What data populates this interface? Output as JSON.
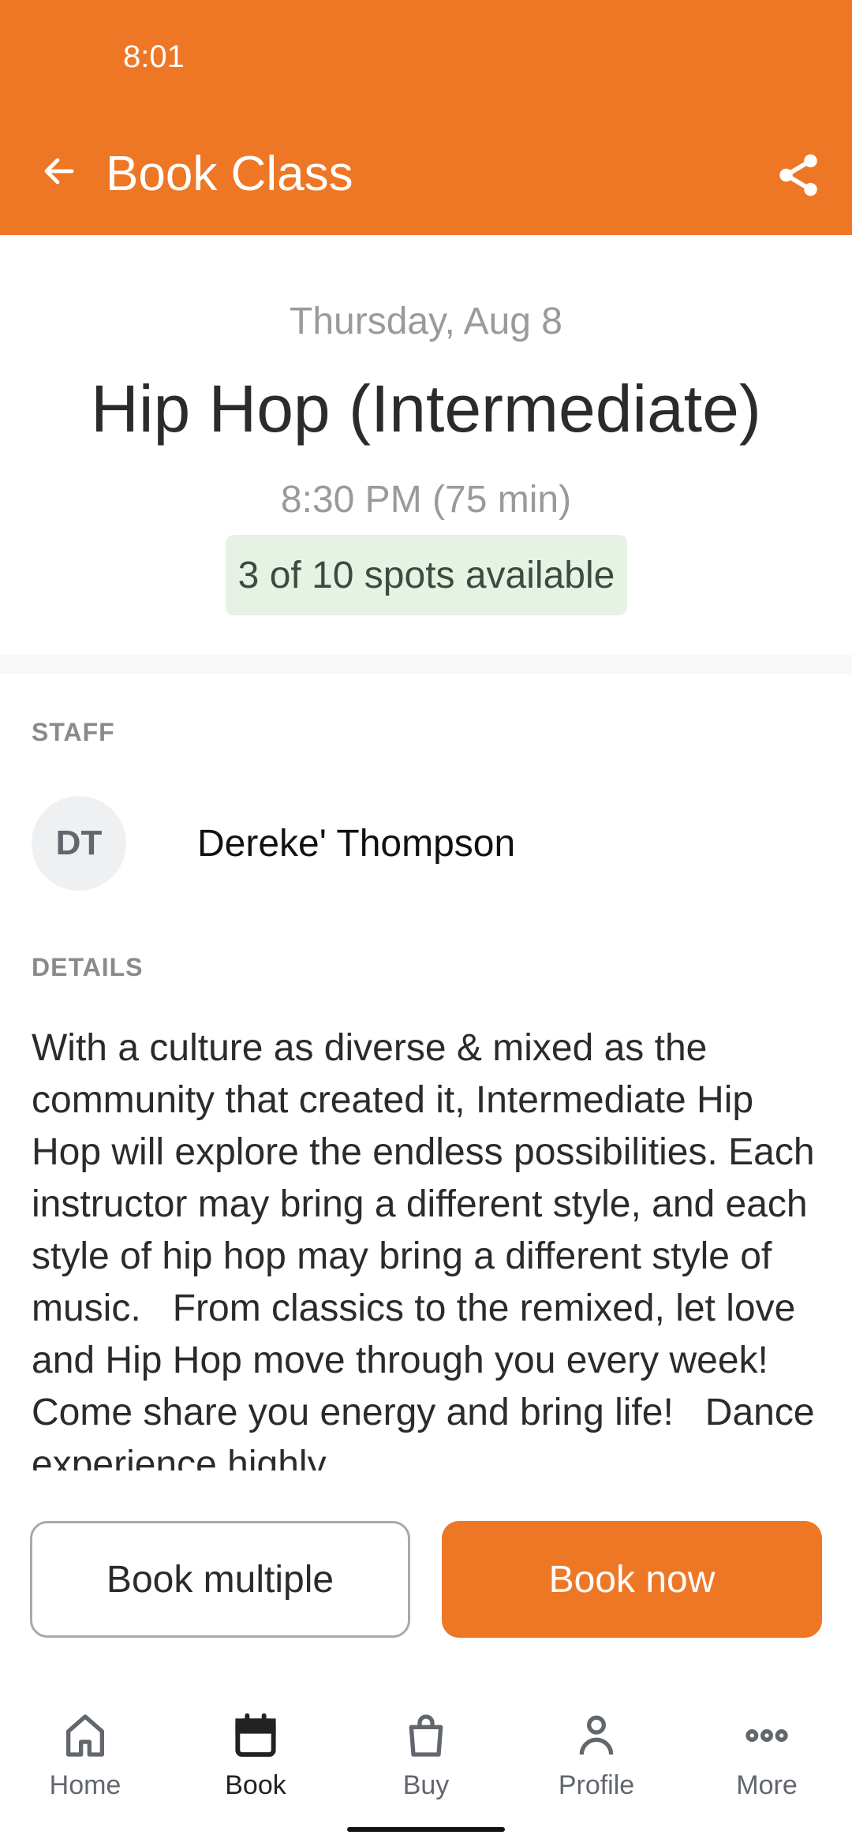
{
  "status_bar": {
    "time": "8:01"
  },
  "app_bar": {
    "title": "Book Class",
    "back_icon": "arrow-left-icon",
    "share_icon": "share-icon",
    "color": "#ee7726"
  },
  "class": {
    "date": "Thursday, Aug 8",
    "name": "Hip Hop (Intermediate)",
    "time": "8:30 PM (75 min)",
    "spots": "3 of 10 spots available"
  },
  "staff": {
    "label": "STAFF",
    "initials": "DT",
    "name": "Dereke' Thompson"
  },
  "details": {
    "label": "DETAILS",
    "text": "With a culture as diverse & mixed as the community that created it, Intermediate Hip Hop will explore the endless possibilities. Each instructor may bring a different style, and each style of hip hop may bring a different style of music.   From classics to the remixed, let love and Hip Hop move through you every week!   Come share you energy and bring life!   Dance experience highly"
  },
  "actions": {
    "book_multiple": "Book multiple",
    "book_now": "Book now"
  },
  "bottom_nav": {
    "items": [
      {
        "label": "Home",
        "icon": "home-icon",
        "active": false
      },
      {
        "label": "Book",
        "icon": "calendar-icon",
        "active": true
      },
      {
        "label": "Buy",
        "icon": "shopping-bag-icon",
        "active": false
      },
      {
        "label": "Profile",
        "icon": "person-icon",
        "active": false
      },
      {
        "label": "More",
        "icon": "more-horizontal-icon",
        "active": false
      }
    ]
  }
}
